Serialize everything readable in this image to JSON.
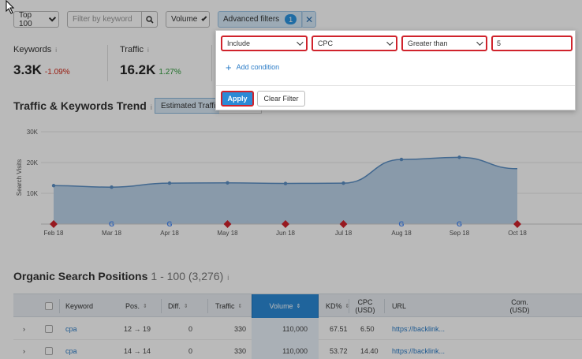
{
  "topbar": {
    "top_select": "Top 100",
    "keyword_placeholder": "Filter by keyword",
    "volume_select": "Volume",
    "advanced_label": "Advanced filters",
    "advanced_count": "1",
    "close_symbol": "✕"
  },
  "metrics": {
    "keywords": {
      "label": "Keywords",
      "value": "3.3K",
      "change": "-1.09%"
    },
    "traffic": {
      "label": "Traffic",
      "value": "16.2K",
      "change": "1.27%"
    },
    "info_symbol": "i"
  },
  "trend": {
    "title": "Traffic & Keywords Trend",
    "tab_active": "Estimated Traffic"
  },
  "chart_data": {
    "type": "area",
    "ylabel": "Search Visits",
    "yticks": [
      "30K",
      "20K",
      "10K"
    ],
    "ylim": [
      0,
      30000
    ],
    "categories": [
      "Feb 18",
      "Mar 18",
      "Apr 18",
      "May 18",
      "Jun 18",
      "Jul 18",
      "Aug 18",
      "Sep 18",
      "Oct 18"
    ],
    "values": [
      12500,
      12000,
      13300,
      13400,
      13200,
      13300,
      21000,
      21700,
      18000
    ],
    "markers": [
      "red",
      "google",
      "google",
      "red",
      "red",
      "red",
      "google",
      "google",
      "red"
    ],
    "color": "#5b8fc4"
  },
  "organic": {
    "title": "Organic Search Positions",
    "range": "1 - 100 (3,276)",
    "columns": [
      "Keyword",
      "Pos.",
      "Diff.",
      "Traffic",
      "Volume",
      "KD%",
      "CPC (USD)",
      "URL",
      "Com. (USD)"
    ],
    "rows": [
      {
        "expand": "›",
        "keyword": "cpa",
        "pos": "12 → 19",
        "diff": "0",
        "traffic": "330",
        "volume": "110,000",
        "kd": "67.51",
        "cpc": "6.50",
        "url": "https://backlink..."
      },
      {
        "expand": "›",
        "keyword": "cpa",
        "pos": "14 → 14",
        "diff": "0",
        "traffic": "330",
        "volume": "110,000",
        "kd": "53.72",
        "cpc": "14.40",
        "url": "https://backlink..."
      }
    ]
  },
  "popup": {
    "include_select": "Include",
    "field_select": "CPC",
    "operator_select": "Greater than",
    "value": "5",
    "add_condition": "Add condition",
    "plus_symbol": "+",
    "apply_label": "Apply",
    "clear_label": "Clear Filter"
  }
}
